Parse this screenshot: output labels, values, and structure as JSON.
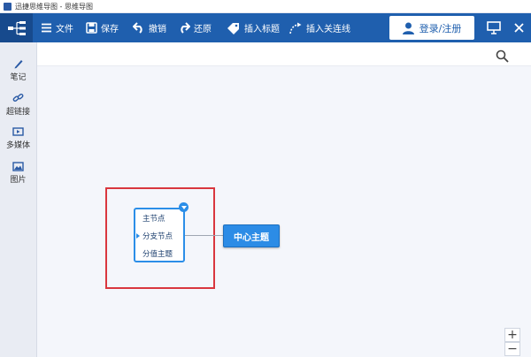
{
  "window": {
    "title": "迅捷思维导图 - 思维导图"
  },
  "toolbar": {
    "file_label": "文件",
    "save_label": "保存",
    "undo_label": "撤销",
    "redo_label": "还原",
    "insert_title_label": "插入标题",
    "insert_link_label": "插入关连线",
    "login_label": "登录/注册",
    "brand_color": "#1f5fae"
  },
  "sidebar": {
    "items": [
      {
        "label": "笔记",
        "icon": "pen-icon"
      },
      {
        "label": "超链接",
        "icon": "link-icon"
      },
      {
        "label": "多媒体",
        "icon": "media-icon"
      },
      {
        "label": "图片",
        "icon": "image-icon"
      }
    ]
  },
  "mindmap": {
    "center_topic": "中心主题",
    "child_nodes": [
      "主节点",
      "分支节点",
      "分值主题"
    ],
    "selection_color": "#d9363e",
    "node_color": "#2c8ce6"
  },
  "zoom": {
    "in_label": "+",
    "out_label": "−"
  }
}
